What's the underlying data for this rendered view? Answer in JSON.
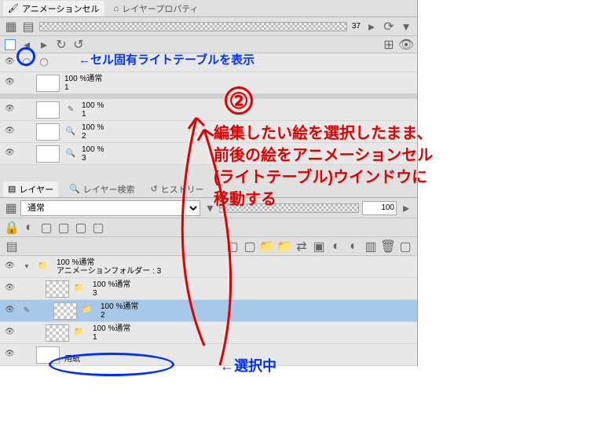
{
  "tabs": {
    "animation_cel": "アニメーションセル",
    "layer_property": "レイヤープロパティ"
  },
  "top": {
    "value": "37"
  },
  "callout": {
    "light_table": "←セル固有ライトテーブルを表示"
  },
  "cells": {
    "header": {
      "opacity": "100 %通常",
      "idx": "1"
    },
    "c1": {
      "opacity": "100 %",
      "idx": "1"
    },
    "c2": {
      "opacity": "100 %",
      "idx": "2"
    },
    "c3": {
      "opacity": "100 %",
      "idx": "3"
    }
  },
  "mid_tabs": {
    "layer": "レイヤー",
    "layer_search": "レイヤー検索",
    "history": "ヒストリー"
  },
  "layer_bar": {
    "blend": "通常",
    "opacity": "100"
  },
  "layers": {
    "folder": {
      "opacity": "100 %通常",
      "name": "アニメーションフォルダー : 3"
    },
    "l3": {
      "opacity": "100 %通常",
      "idx": "3"
    },
    "l2": {
      "opacity": "100 %通常",
      "idx": "2"
    },
    "l1": {
      "opacity": "100 %通常",
      "idx": "1"
    },
    "paper": {
      "name": "用紙"
    }
  },
  "anno": {
    "num": "②",
    "text": "編集したい絵を選択したまま、\n前後の絵をアニメーションセル\n(ライトテーブル)ウインドウに\n移動する",
    "selected": "←選択中"
  }
}
